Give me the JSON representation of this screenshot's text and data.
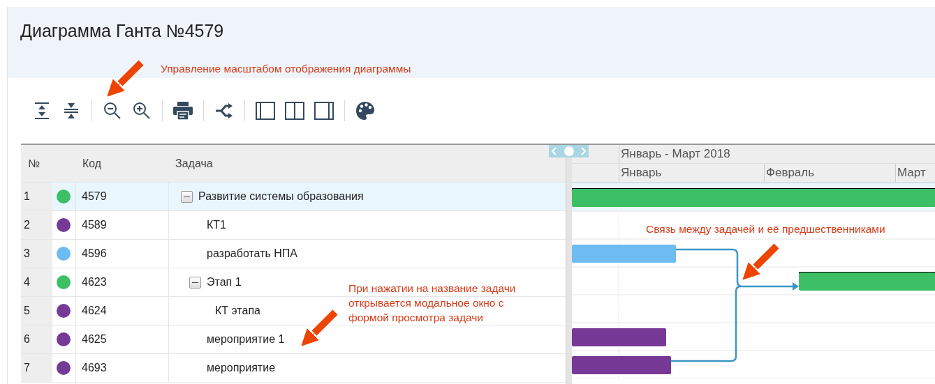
{
  "title": "Диаграмма Ганта №4579",
  "columns": [
    "№",
    "Код",
    "Задача"
  ],
  "timeline": {
    "period": "Январь - Март 2018",
    "months": [
      "Январь",
      "Февраль",
      "Март"
    ]
  },
  "tasks": [
    {
      "number": "1",
      "code": "4579",
      "name": "Развитие системы образования",
      "color": "#3dbf66",
      "selected": true,
      "expanded": true,
      "children": [
        {
          "number": "2",
          "code": "4589",
          "name": "КТ1",
          "color": "#763a96",
          "selected": false
        },
        {
          "number": "3",
          "code": "4596",
          "name": "разработать НПА",
          "color": "#6cbcf2",
          "selected": false
        },
        {
          "number": "4",
          "code": "4623",
          "name": "Этап 1",
          "color": "#3dbf66",
          "selected": false,
          "expanded": true,
          "children": [
            {
              "number": "5",
              "code": "4624",
              "name": "КТ этапа",
              "color": "#763a96",
              "selected": false
            }
          ]
        },
        {
          "number": "6",
          "code": "4625",
          "name": "мероприятие 1",
          "color": "#763a96",
          "selected": false
        },
        {
          "number": "7",
          "code": "4693",
          "name": "мероприятие",
          "color": "#763a96",
          "selected": false
        }
      ]
    }
  ],
  "annotations": [
    "Управление масштабом отображения диаграммы",
    "При нажатии на название задачи открывается модальное окно с формой просмотра задачи",
    "Связь между задачей и её предшественниками"
  ]
}
